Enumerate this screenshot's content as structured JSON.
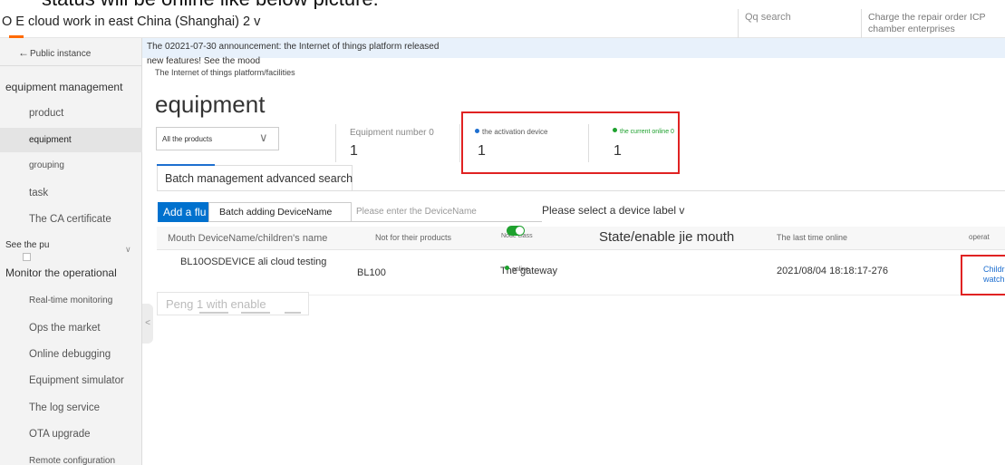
{
  "caption": "status will be online like below picture:",
  "header": {
    "title": "O E cloud work in east China (Shanghai) 2 v",
    "search_label": "Qq search",
    "notice": "Charge the repair order ICP chamber enterprises"
  },
  "sidebar": {
    "back_label": "Public instance",
    "group1": "equipment management",
    "items1": [
      "product",
      "equipment",
      "grouping",
      "task",
      "The CA certificate"
    ],
    "group2": "See the pu",
    "group3": "Monitor the operational",
    "items3": [
      "Real-time monitoring",
      "Ops the market",
      "Online debugging",
      "Equipment simulator",
      "The log service",
      "OTA upgrade",
      "Remote configuration"
    ]
  },
  "main": {
    "announcement_line1": "The 02021-07-30 announcement: the Internet of things platform released",
    "announcement_line2": "new features! See the mood",
    "breadcrumb": "The Internet of things platform/facilities",
    "page_title": "equipment",
    "product_select": "All the products",
    "stats": [
      {
        "label": "Equipment number 0",
        "value": "1"
      },
      {
        "label": "the activation device",
        "value": "1"
      },
      {
        "label": "the current online 0",
        "value": "1"
      }
    ],
    "advanced_tab": "Batch management advanced search",
    "add_button": "Add a flu",
    "batch_button": "Batch adding DeviceName",
    "search_placeholder": "Please enter the DeviceName",
    "label_select": "Please select a device label v",
    "columns": [
      "Mouth DeviceName/children's name",
      "Not for their products",
      "Node class",
      "State/enable jie mouth",
      "The last time online",
      "operat"
    ],
    "row": {
      "device_name": "BL10OSDEVICE ali cloud testing",
      "product": "BL100",
      "node_class": "The gateway",
      "status": "online",
      "last_online": "2021/08/04 18:18:17-276",
      "op_link1": "Childr",
      "op_link2": "watch"
    },
    "pager_text": "Peng 1 with enable"
  },
  "colors": {
    "primary": "#0071ce",
    "highlight": "#e02222",
    "online": "#1ea12e",
    "announce_bg": "#e8f1fb"
  }
}
